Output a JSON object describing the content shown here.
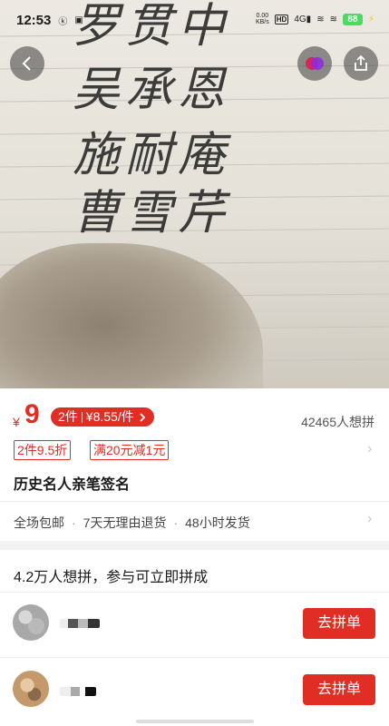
{
  "status_bar": {
    "time": "12:53",
    "net_speed_value": "0.00",
    "net_speed_unit": "KB/s",
    "hd": "HD",
    "signal": "4G",
    "battery": "88"
  },
  "hero": {
    "handwritten_names": [
      "罗贯中",
      "吴承恩",
      "施耐庵",
      "曹雪芹"
    ]
  },
  "product": {
    "currency": "¥",
    "price": "9",
    "bundle_qty": "2件",
    "bundle_price": "¥8.55/件",
    "want_count": "42465人想拼",
    "promo_tags": [
      "2件9.5折",
      "满20元减1元"
    ],
    "title": "历史名人亲笔签名",
    "services": [
      "全场包邮",
      "7天无理由退货",
      "48小时发货"
    ]
  },
  "group_buy": {
    "title": "4.2万人想拼，参与可立即拼成",
    "join_label": "去拼单"
  },
  "colors": {
    "accent": "#e02e24"
  },
  "icons": [
    "back-icon",
    "multi-color-icon",
    "share-icon",
    "chevron-right-icon"
  ]
}
